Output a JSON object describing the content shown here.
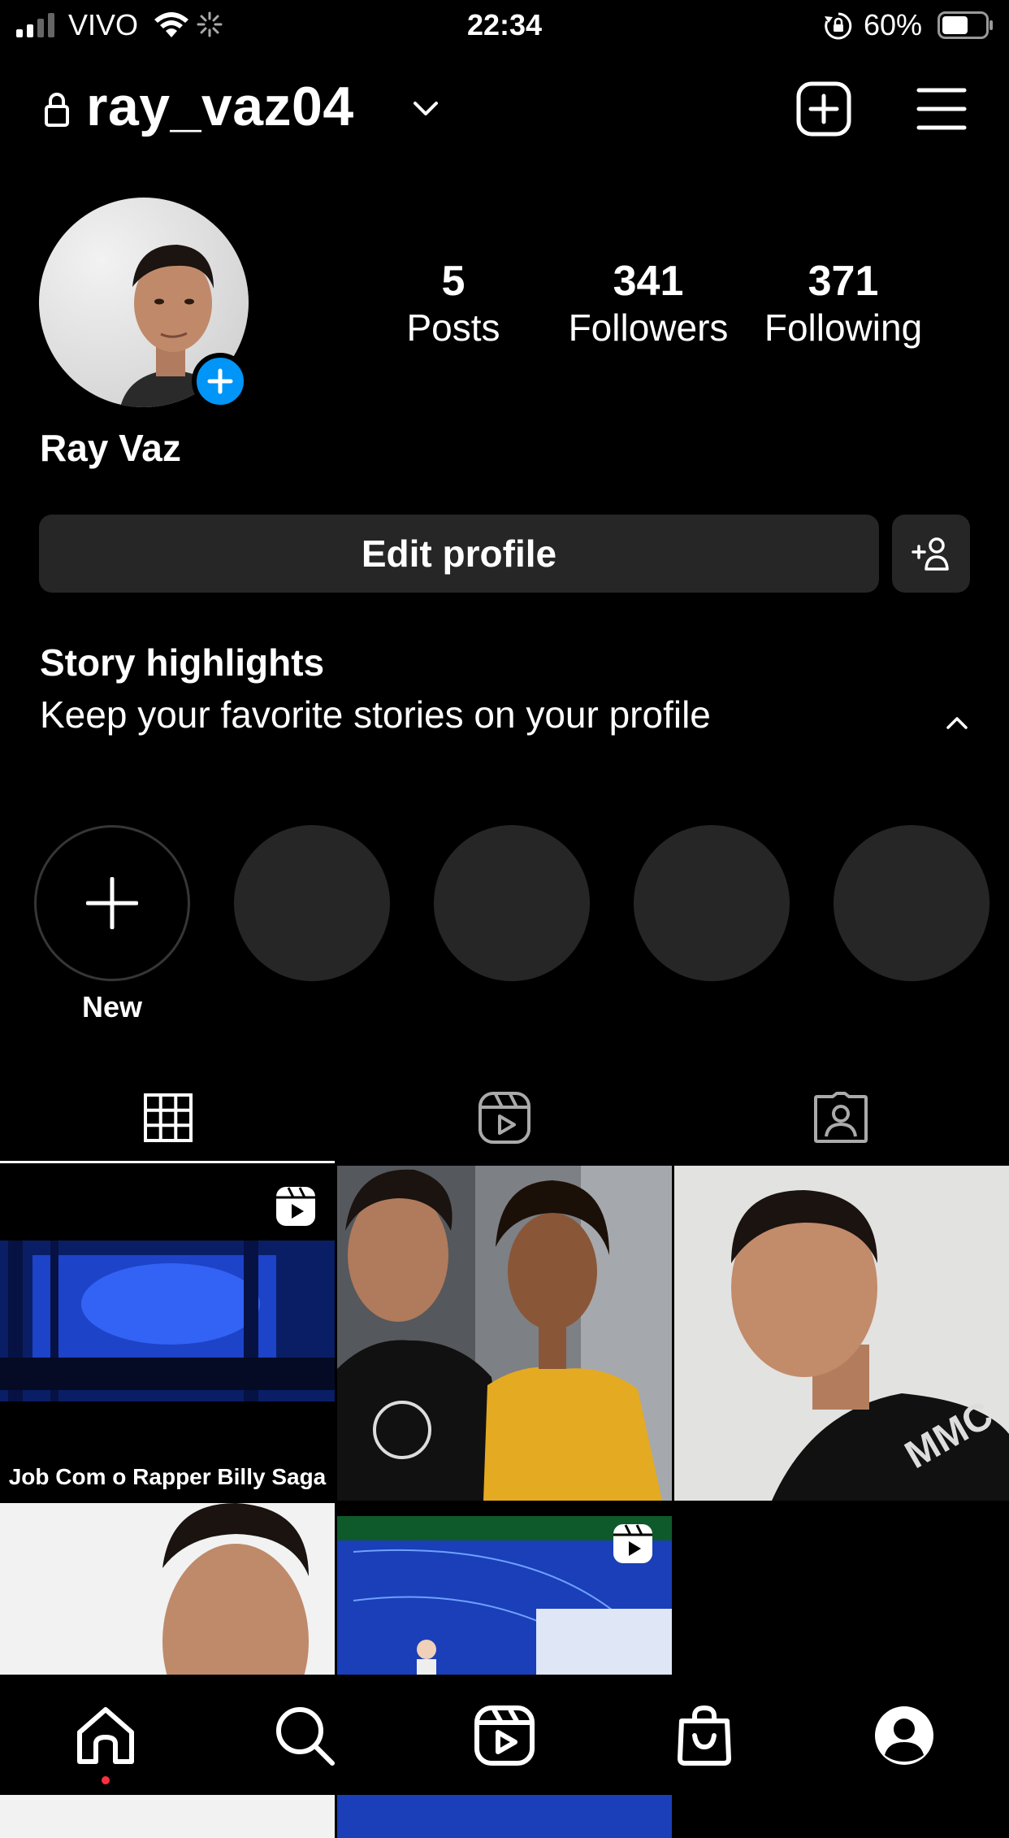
{
  "status_bar": {
    "carrier": "VIVO",
    "time": "22:34",
    "battery": "60%"
  },
  "header": {
    "username": "ray_vaz04",
    "icons": [
      "lock-icon",
      "chevron-down-icon",
      "new-post-icon",
      "menu-icon"
    ]
  },
  "profile": {
    "full_name": "Ray Vaz",
    "stats": [
      {
        "value": "5",
        "label": "Posts"
      },
      {
        "value": "341",
        "label": "Followers"
      },
      {
        "value": "371",
        "label": "Following"
      }
    ],
    "edit_button": "Edit profile"
  },
  "highlights": {
    "title": "Story highlights",
    "subtitle": "Keep your favorite stories on your profile",
    "new_label": "New"
  },
  "tabs": [
    "grid-tab",
    "reels-tab",
    "tagged-tab"
  ],
  "grid": {
    "posts": [
      {
        "caption": "Job Com o Rapper Billy Saga",
        "type": "reel"
      },
      {
        "caption": "",
        "type": "photo"
      },
      {
        "caption": "",
        "type": "photo"
      },
      {
        "caption": "",
        "type": "photo"
      },
      {
        "caption": "",
        "type": "reel"
      }
    ]
  },
  "bottom_nav": [
    "home-icon",
    "search-icon",
    "reels-icon",
    "shop-icon",
    "profile-icon"
  ],
  "colors": {
    "background": "#000000",
    "surface": "#262626",
    "accent": "#0095f6",
    "notification": "#ff3040"
  }
}
